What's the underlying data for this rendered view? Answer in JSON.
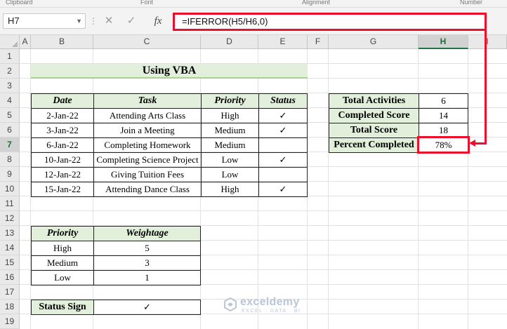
{
  "ribbon": {
    "groups": [
      "Clipboard",
      "Font",
      "Alignment",
      "Number"
    ]
  },
  "formula_bar": {
    "name_box": "H7",
    "cancel_icon": "close-icon",
    "enter_icon": "check-icon",
    "fx_label": "fx",
    "formula": "=IFERROR(H5/H6,0)"
  },
  "sheet": {
    "columns": [
      "A",
      "B",
      "C",
      "D",
      "E",
      "F",
      "G",
      "H",
      "I"
    ],
    "active_column": "H",
    "rows": [
      "1",
      "2",
      "3",
      "4",
      "5",
      "6",
      "7",
      "8",
      "9",
      "10",
      "11",
      "12",
      "13",
      "14",
      "15",
      "16",
      "17",
      "18",
      "19"
    ],
    "active_row": "7"
  },
  "title": "Using VBA",
  "tasks_table": {
    "headers": [
      "Date",
      "Task",
      "Priority",
      "Status"
    ],
    "rows": [
      [
        "2-Jan-22",
        "Attending Arts Class",
        "High",
        "✓"
      ],
      [
        "3-Jan-22",
        "Join a Meeting",
        "Medium",
        "✓"
      ],
      [
        "6-Jan-22",
        "Completing Homework",
        "Medium",
        ""
      ],
      [
        "10-Jan-22",
        "Completing Science Project",
        "Low",
        "✓"
      ],
      [
        "12-Jan-22",
        "Giving Tuition Fees",
        "Low",
        ""
      ],
      [
        "15-Jan-22",
        "Attending Dance Class",
        "High",
        "✓"
      ]
    ]
  },
  "summary_table": {
    "rows": [
      [
        "Total Activities",
        "6"
      ],
      [
        "Completed Score",
        "14"
      ],
      [
        "Total Score",
        "18"
      ],
      [
        "Percent Completed",
        "78%"
      ]
    ]
  },
  "weightage_table": {
    "headers": [
      "Priority",
      "Weightage"
    ],
    "rows": [
      [
        "High",
        "5"
      ],
      [
        "Medium",
        "3"
      ],
      [
        "Low",
        "1"
      ]
    ]
  },
  "status_sign": {
    "label": "Status Sign",
    "value": "✓"
  },
  "watermark": {
    "name": "exceldemy",
    "tagline": "EXCEL · DATA · BI"
  },
  "colors": {
    "accent_red": "#e8102a",
    "header_green": "#e2efda",
    "excel_green": "#217346"
  }
}
